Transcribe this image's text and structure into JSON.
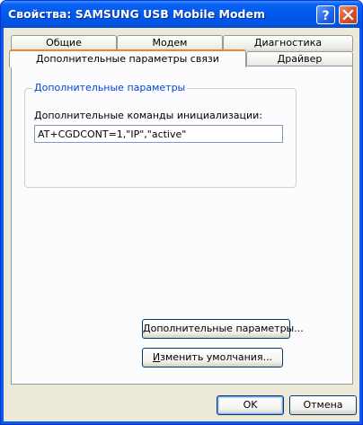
{
  "window": {
    "title": "Свойства: SAMSUNG USB Mobile Modem"
  },
  "tabs": {
    "row_back": [
      {
        "label": "Общие"
      },
      {
        "label": "Модем"
      },
      {
        "label": "Диагностика"
      }
    ],
    "row_front": [
      {
        "label": "Дополнительные параметры связи",
        "active": true
      },
      {
        "label": "Драйвер"
      }
    ]
  },
  "group": {
    "legend": "Дополнительные параметры",
    "init_label": "Дополнительные команды инициализации:",
    "init_value": "AT+CGDCONT=1,\"IP\",\"active\""
  },
  "buttons": {
    "advanced": {
      "pre": "",
      "ul": "Д",
      "post": "ополнительные параметры..."
    },
    "defaults": {
      "pre": "",
      "ul": "И",
      "post": "зменить умолчания..."
    },
    "ok": "OK",
    "cancel": "Отмена"
  },
  "colors": {
    "titlebar": "#0054e3",
    "accent_tab": "#e68b2c",
    "dialog_bg": "#ece9d8"
  }
}
